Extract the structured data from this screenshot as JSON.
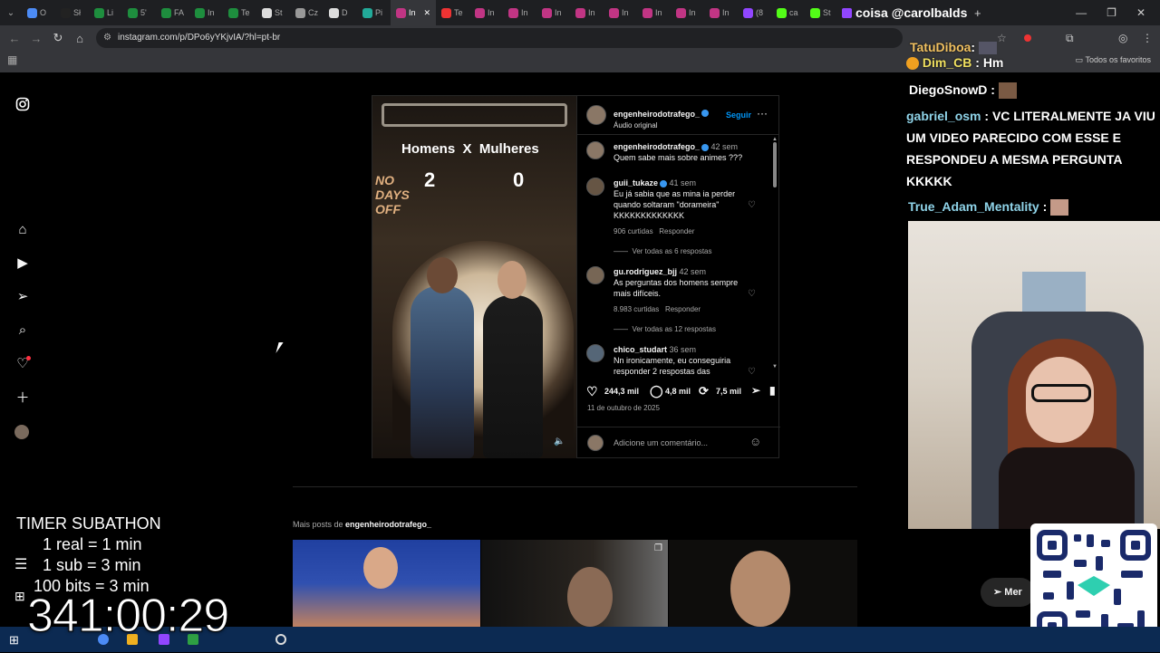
{
  "browser": {
    "url": "instagram.com/p/DPo6yYKjvIA/?hl=pt-br",
    "tabs": [
      {
        "label": "O",
        "color": "#4c8bf5"
      },
      {
        "label": "Sł",
        "color": "#222"
      },
      {
        "label": "Li",
        "color": "#1e8e3e"
      },
      {
        "label": "5'",
        "color": "#1e8e3e"
      },
      {
        "label": "FA",
        "color": "#1e8e3e"
      },
      {
        "label": "In",
        "color": "#1e8e3e"
      },
      {
        "label": "Te",
        "color": "#1e8e3e"
      },
      {
        "label": "St",
        "color": "#ddd"
      },
      {
        "label": "Cz",
        "color": "#999"
      },
      {
        "label": "D",
        "color": "#ddd"
      },
      {
        "label": "Pi",
        "color": "#2a9"
      },
      {
        "label": "In",
        "color": "#c13584"
      },
      {
        "label": "Te",
        "color": "#e33"
      },
      {
        "label": "In",
        "color": "#c13584"
      },
      {
        "label": "In",
        "color": "#c13584"
      },
      {
        "label": "In",
        "color": "#c13584"
      },
      {
        "label": "In",
        "color": "#c13584"
      },
      {
        "label": "In",
        "color": "#c13584"
      },
      {
        "label": "In",
        "color": "#c13584"
      },
      {
        "label": "In",
        "color": "#c13584"
      },
      {
        "label": "In",
        "color": "#c13584"
      },
      {
        "label": "(8",
        "color": "#9146ff"
      },
      {
        "label": "ca",
        "color": "#53fc18"
      },
      {
        "label": "St",
        "color": "#53fc18"
      }
    ],
    "twitch_tab": "coisa @carolbalds",
    "new_tab": "+",
    "bookmarks": "Todos os favoritos"
  },
  "post": {
    "author": "engenheirodotrafego_",
    "audio": "Áudio original",
    "follow": "Seguir",
    "video": {
      "left": "Homens",
      "sep": "X",
      "right": "Mulheres",
      "score_left": "2",
      "score_right": "0",
      "brand1": "NO",
      "brand2": "DAYS",
      "brand3": "OFF"
    },
    "caption": {
      "user": "engenheirodotrafego_",
      "time": "42 sem",
      "text": "Quem sabe mais sobre animes ???"
    },
    "comments": [
      {
        "user": "guii_tukaze",
        "time": "41 sem",
        "text": "Eu já sabia que as mina ia perder quando soltaram \"dorameira\" KKKKKKKKKKKKK",
        "likes": "906 curtidas",
        "reply": "Responder",
        "replies": "Ver todas as 6 respostas"
      },
      {
        "user": "gu.rodriguez_bjj",
        "time": "42 sem",
        "text": "As perguntas dos homens sempre mais difíceis.",
        "likes": "8.983 curtidas",
        "reply": "Responder",
        "replies": "Ver todas as 12 respostas"
      },
      {
        "user": "chico_studart",
        "time": "36 sem",
        "text": "Nn ironicamente, eu conseguiria responder 2 respostas das"
      }
    ],
    "stats": {
      "likes": "244,3 mil",
      "comments": "4,8 mil",
      "reposts": "7,5 mil"
    },
    "date": "11 de outubro de 2025",
    "add_comment": "Adicione um comentário..."
  },
  "more_posts": {
    "prefix": "Mais posts de",
    "user": "engenheirodotrafego_"
  },
  "chat": [
    {
      "name": "TatuDiboa",
      "sep": ":",
      "msg": "",
      "color": "#f0c060"
    },
    {
      "name": "Dim_CB",
      "sep": ":",
      "msg": "Hm",
      "color": "#f0e060"
    },
    {
      "name": "DiegoSnowD",
      "sep": ":",
      "msg": "",
      "color": "#ffffff"
    },
    {
      "name": "gabriel_osm",
      "sep": ":",
      "msg": "VC LITERALMENTE JA VIU UM VIDEO PARECIDO COM ESSE E RESPONDEU A MESMA PERGUNTA KKKKK",
      "color": "#8fd3e8"
    },
    {
      "name": "True_Adam_Mentality",
      "sep": ":",
      "msg": "",
      "color": "#8fd3e8"
    }
  ],
  "timer": {
    "title": "TIMER SUBATHON",
    "line1": "1 real = 1 min",
    "line2": "1 sub = 3 min",
    "line3": "100 bits = 3 min",
    "value": "341:00:29"
  },
  "messages_pill": "Mer",
  "colors": {
    "bg": "#000000",
    "border": "#262626",
    "verified": "#3897f0",
    "follow": "#0095f6",
    "taskbar": "#0c2a52"
  }
}
